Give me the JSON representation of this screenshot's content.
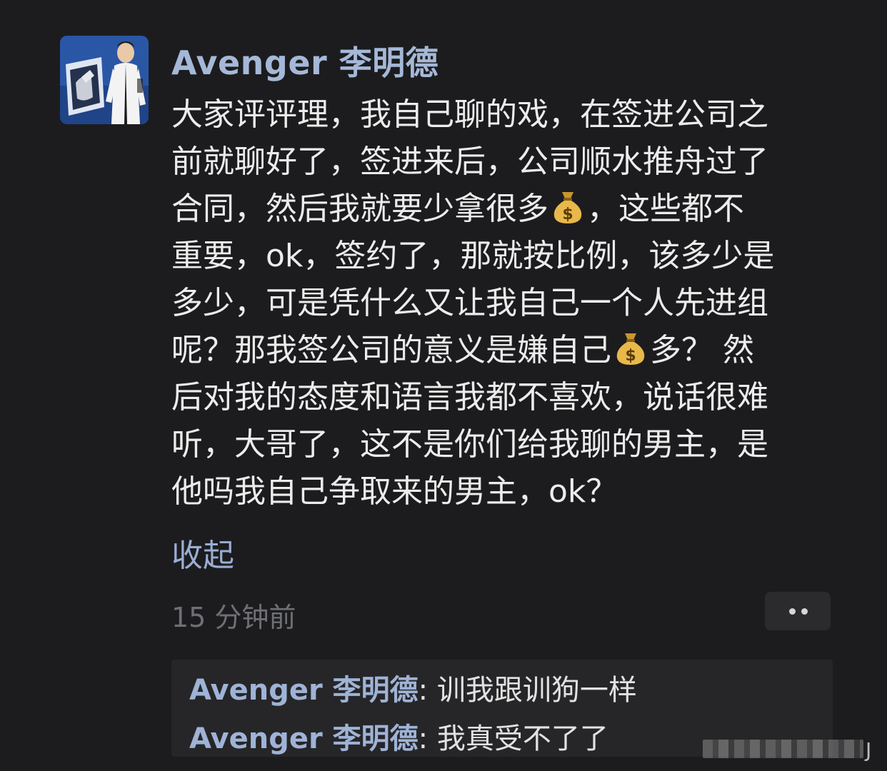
{
  "post": {
    "author": "Avenger 李明德",
    "avatar_icon": "profile-photo",
    "body_lines": [
      [
        "大家评评理，我自己聊的戏，在签进公司之"
      ],
      [
        "前就聊好了，签进来后，公司顺水推舟过了"
      ],
      [
        "合同，然后我就要少拿很多",
        "💰",
        "，这些都不"
      ],
      [
        "重要，ok，签约了，那就按比例，该多少是"
      ],
      [
        "多少，可是凭什么又让我自己一个人先进组"
      ],
      [
        "呢？那我签公司的意义是嫌自己",
        "💰",
        "多？ 然"
      ],
      [
        "后对我的态度和语言我都不喜欢，说话很难"
      ],
      [
        "听，大哥了，这不是你们给我聊的男主，是"
      ],
      [
        "他吗我自己争取来的男主，ok？"
      ]
    ],
    "money_emoji_name": "money-bag-icon",
    "collapse_label": "收起",
    "timestamp": "15 分钟前",
    "more_icon": "more-icon"
  },
  "replies": [
    {
      "author": "Avenger 李明德",
      "separator": ": ",
      "text": "训我跟训狗一样"
    },
    {
      "author": "Avenger 李明德",
      "separator": ": ",
      "text": "我真受不了了"
    }
  ],
  "watermark": {
    "visible_letter": "J"
  },
  "colors": {
    "background": "#1c1c1e",
    "author_name": "#a5b8d8",
    "body_text": "#ececec",
    "link": "#9aaed3",
    "timestamp": "#6f7075",
    "reply_box": "#262628",
    "money_bag": "#e8b84a"
  }
}
